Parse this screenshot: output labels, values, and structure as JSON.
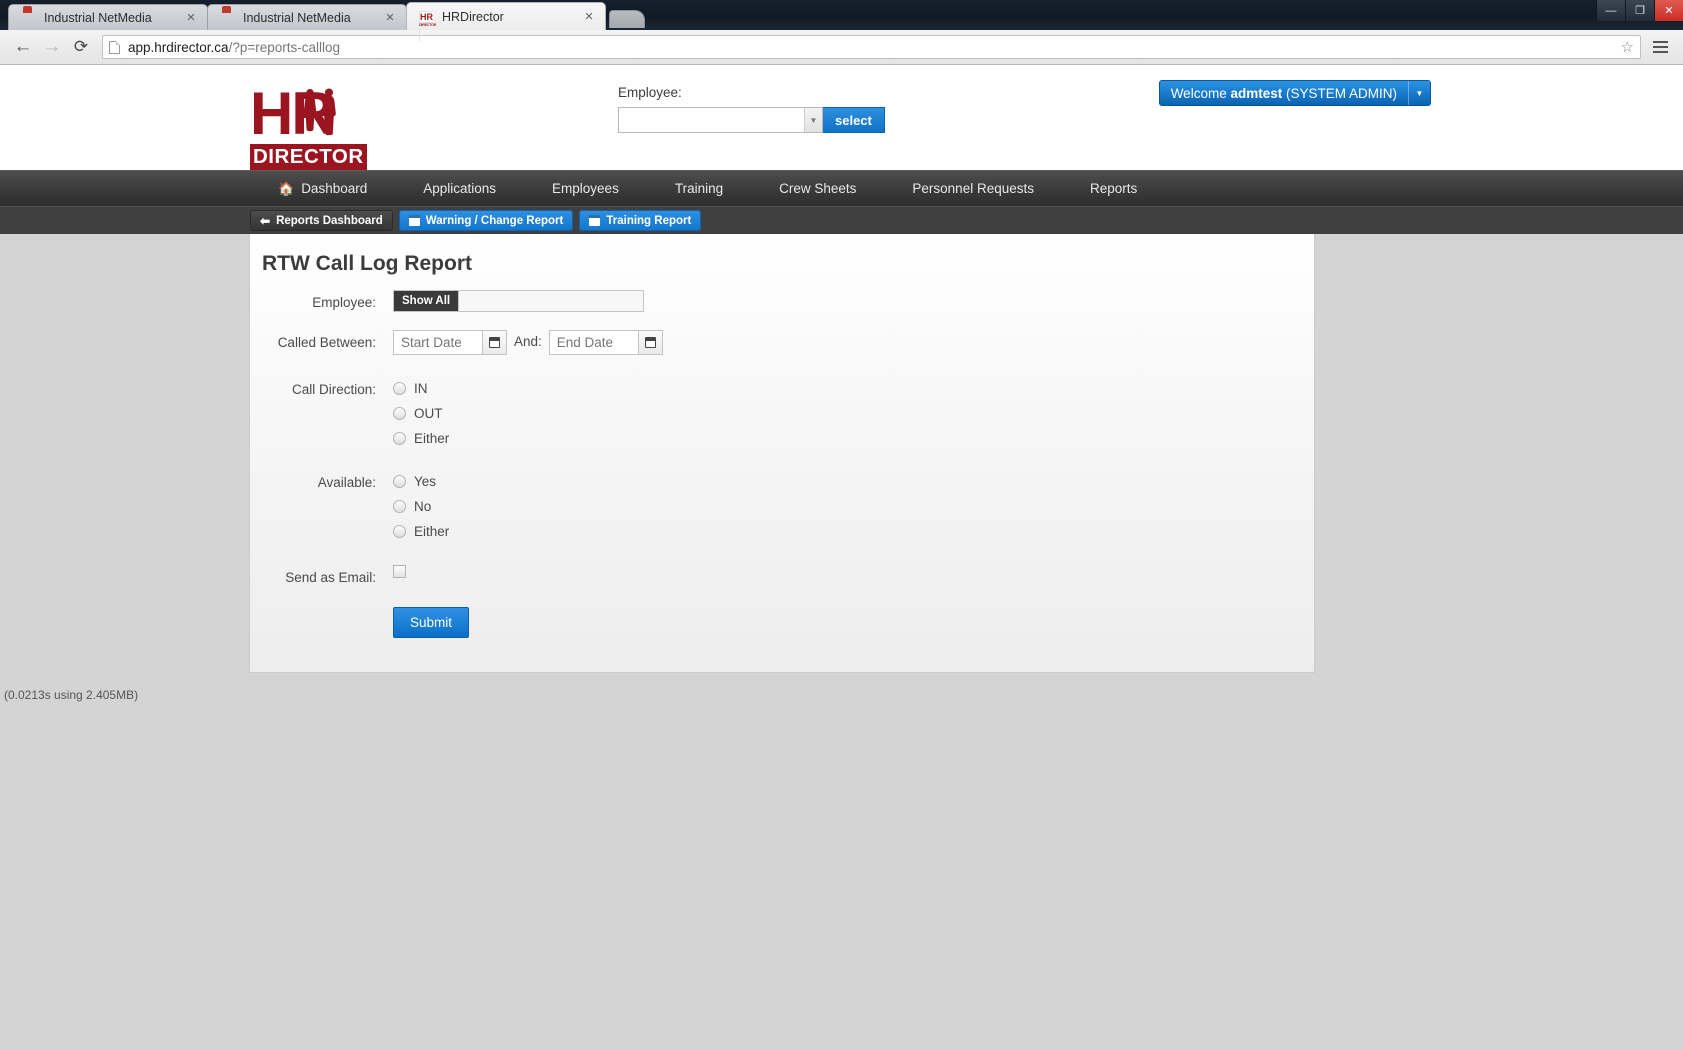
{
  "browser": {
    "tabs": [
      {
        "title": "Industrial NetMedia",
        "icon": "netmedia-favicon",
        "active": false
      },
      {
        "title": "Industrial NetMedia",
        "icon": "netmedia-favicon",
        "active": false
      },
      {
        "title": "HRDirector",
        "icon": "hrdirector-favicon",
        "active": true
      }
    ],
    "close_label": "×",
    "new_tab_label": "",
    "window_controls": {
      "minimize": "—",
      "maximize": "❐",
      "close": "✕"
    },
    "nav": {
      "back": "←",
      "forward": "→",
      "reload": "⟳"
    },
    "url": {
      "main": "app.hrdirector.ca",
      "rest": "/?p=reports-calllog"
    },
    "bookmark_icon": "☆",
    "menu_icon": "hamburger-menu-icon"
  },
  "header": {
    "logo": {
      "mark": "HR",
      "word": "DIRECTOR"
    },
    "employee_label": "Employee:",
    "employee_value": "",
    "employee_placeholder": "",
    "select_button": "select",
    "welcome_text_prefix": "Welcome ",
    "welcome_user": "admtest",
    "welcome_text_suffix": " (SYSTEM ADMIN)",
    "welcome_caret": "▼"
  },
  "mainnav": {
    "items": [
      {
        "label": "Dashboard",
        "icon": "home-icon"
      },
      {
        "label": "Applications",
        "icon": ""
      },
      {
        "label": "Employees",
        "icon": ""
      },
      {
        "label": "Training",
        "icon": ""
      },
      {
        "label": "Crew Sheets",
        "icon": ""
      },
      {
        "label": "Personnel Requests",
        "icon": ""
      },
      {
        "label": "Reports",
        "icon": ""
      }
    ]
  },
  "subnav": {
    "items": [
      {
        "label": "Reports Dashboard",
        "style": "dark",
        "icon": "back-arrow-icon"
      },
      {
        "label": "Warning / Change Report",
        "style": "blue",
        "icon": "calendar-icon"
      },
      {
        "label": "Training Report",
        "style": "blue",
        "icon": "calendar-icon"
      }
    ]
  },
  "form": {
    "title": "RTW Call Log Report",
    "employee": {
      "label": "Employee:",
      "show_all_button": "Show All",
      "value": "",
      "placeholder": ""
    },
    "called_between": {
      "label": "Called Between:",
      "start_placeholder": "Start Date",
      "start_value": "",
      "and_label": "And:",
      "end_placeholder": "End Date",
      "end_value": ""
    },
    "call_direction": {
      "label": "Call Direction:",
      "options": [
        {
          "label": "IN",
          "selected": false
        },
        {
          "label": "OUT",
          "selected": false
        },
        {
          "label": "Either",
          "selected": false
        }
      ]
    },
    "available": {
      "label": "Available:",
      "options": [
        {
          "label": "Yes",
          "selected": false
        },
        {
          "label": "No",
          "selected": false
        },
        {
          "label": "Either",
          "selected": false
        }
      ]
    },
    "send_as_email": {
      "label": "Send as Email:",
      "checked": false
    },
    "submit_label": "Submit"
  },
  "footer": {
    "note": "(0.0213s using 2.405MB)"
  },
  "colors": {
    "brand_red": "#9b1520",
    "accent_blue": "#1377cd",
    "nav_dark": "#3a3a3a",
    "subnav_dark": "#404040"
  }
}
